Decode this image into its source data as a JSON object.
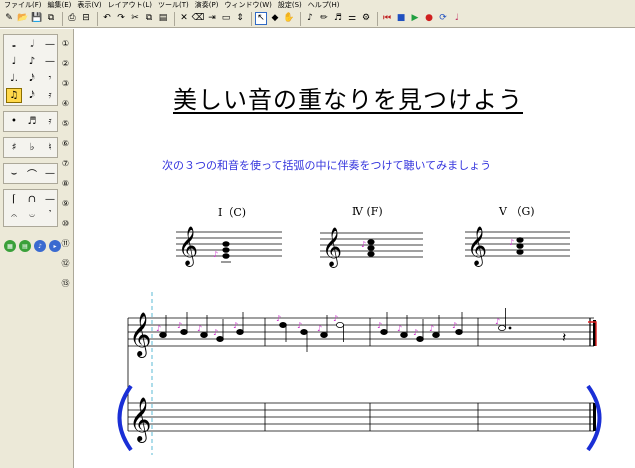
{
  "menu": [
    "ファイル(F)",
    "編集(E)",
    "表示(V)",
    "レイアウト(L)",
    "ツール(T)",
    "演奏(P)",
    "ウィンドウ(W)",
    "設定(S)",
    "ヘルプ(H)"
  ],
  "toolbar_icons": [
    "new-icon",
    "open-icon",
    "save-icon",
    "save-as-icon",
    "print-icon",
    "print-preview-icon",
    "undo-icon",
    "redo-icon",
    "cut-icon",
    "copy-icon",
    "paste-icon",
    "delete-icon",
    "erase-icon",
    "insert-icon",
    "select-icon",
    "move-icon",
    "arrow-icon",
    "fill-icon",
    "hand-icon",
    "note-input-icon",
    "pen-icon",
    "mute-icon",
    "mixer-icon",
    "settings-icon",
    "rewind-icon",
    "stop-icon",
    "play-icon",
    "record-icon",
    "loop-icon",
    "tempo-icon"
  ],
  "palette": {
    "notes": [
      "𝅝",
      "𝅗𝅥",
      "—",
      "♩",
      "♪",
      "—",
      "♩.",
      "𝅘𝅥𝅯",
      "𝄾",
      "♫",
      "𝅘𝅥𝅯",
      "𝄿"
    ],
    "dots": [
      "•",
      "♬",
      "𝄿"
    ],
    "accidentals": [
      "♯",
      "♭",
      "♮"
    ],
    "ties": [
      "⌣",
      "⌒",
      "—"
    ],
    "misc": [
      "⌈",
      "∩",
      "—",
      "𝄐",
      "𝄑",
      "𝄒"
    ],
    "side": [
      "①",
      "②",
      "③",
      "④",
      "⑤",
      "⑥",
      "⑦",
      "⑧",
      "⑨",
      "⑩",
      "⑪",
      "⑫",
      "⑬"
    ]
  },
  "score": {
    "title": "美しい音の重なりを見つけよう",
    "instruction": "次の３つの和音を使って括弧の中に伴奏をつけて聴いてみましょう",
    "chords": [
      {
        "label": "I（C)",
        "name": "C"
      },
      {
        "label": "Ⅳ (F)",
        "name": "F"
      },
      {
        "label": "V （G)",
        "name": "G"
      }
    ]
  },
  "colors": {
    "accent": "#3333dd",
    "bracket": "#1a2fd6",
    "note_marker": "#cc33cc",
    "end_bar": "#e02020",
    "cursor": "#33aacc"
  }
}
